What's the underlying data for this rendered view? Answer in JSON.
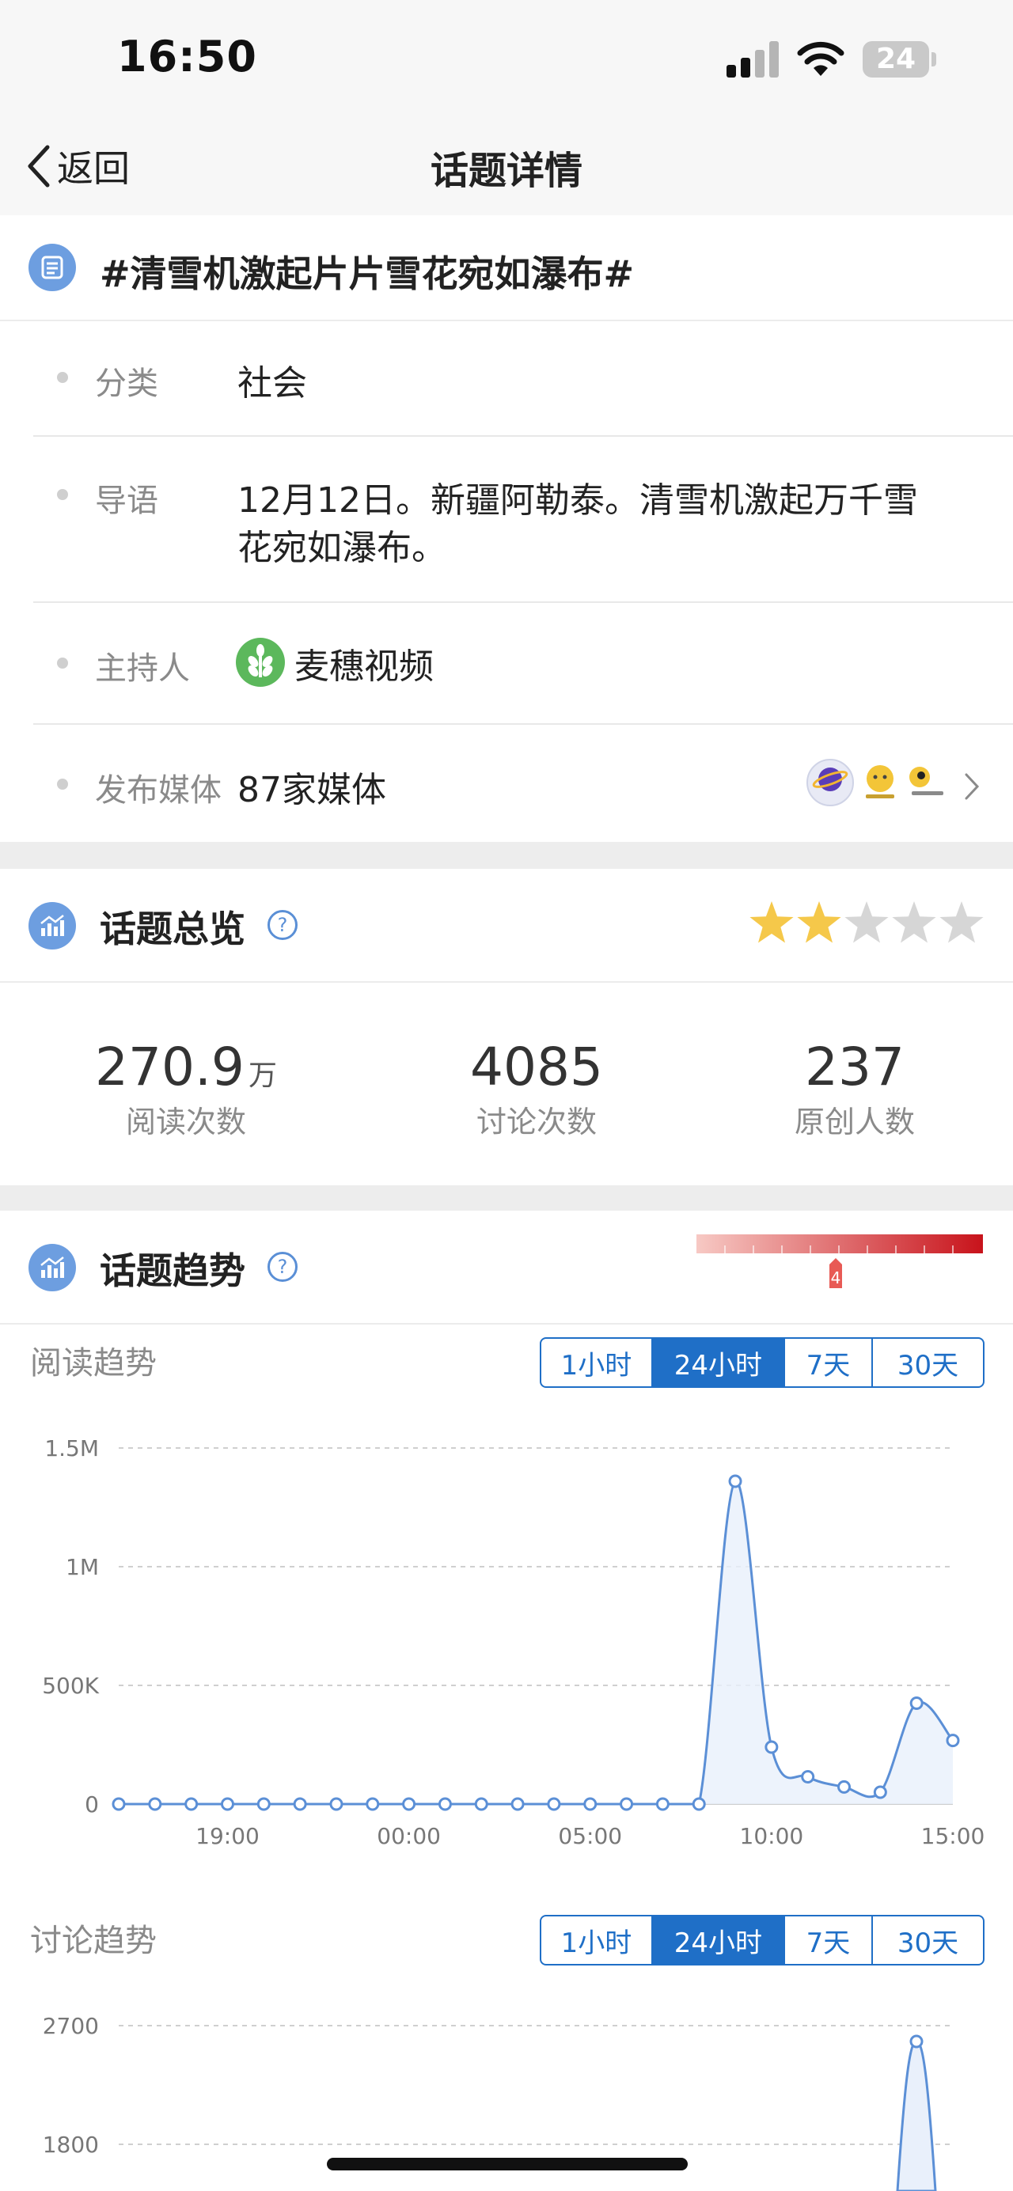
{
  "status_bar": {
    "time": "16:50",
    "battery": "24"
  },
  "nav": {
    "back_label": "返回",
    "title": "话题详情"
  },
  "topic": {
    "title": "#清雪机激起片片雪花宛如瀑布#",
    "category_label": "分类",
    "category_value": "社会",
    "intro_label": "导语",
    "intro_value_line1": "12月12日。新疆阿勒泰。清雪机激起万千雪",
    "intro_value_line2": "花宛如瀑布。",
    "host_label": "主持人",
    "host_value": "麦穗视频",
    "media_label": "发布媒体",
    "media_value": "87家媒体"
  },
  "overview": {
    "title": "话题总览",
    "rating": 2,
    "rating_max": 5,
    "stats": [
      {
        "value": "270.9",
        "unit": "万",
        "label": "阅读次数"
      },
      {
        "value": "4085",
        "unit": "",
        "label": "讨论次数"
      },
      {
        "value": "237",
        "unit": "",
        "label": "原创人数"
      }
    ]
  },
  "trend": {
    "title": "话题趋势",
    "heat_level": "4",
    "ranges": [
      "1小时",
      "24小时",
      "7天",
      "30天"
    ],
    "active_range": "24小时",
    "read_chart_title": "阅读趋势",
    "discuss_chart_title": "讨论趋势"
  },
  "colors": {
    "accent": "#1f6fc7",
    "chart_line": "#5b8fd6",
    "star_on": "#f5c84a",
    "star_off": "#d6d6d6"
  },
  "chart_data": [
    {
      "type": "area",
      "title": "阅读趋势",
      "x": [
        "16:00",
        "17:00",
        "18:00",
        "19:00",
        "20:00",
        "21:00",
        "22:00",
        "23:00",
        "00:00",
        "01:00",
        "02:00",
        "03:00",
        "04:00",
        "05:00",
        "06:00",
        "07:00",
        "08:00",
        "09:00",
        "10:00",
        "11:00",
        "12:00",
        "13:00",
        "14:00",
        "15:00"
      ],
      "x_tick_labels": [
        "19:00",
        "00:00",
        "05:00",
        "10:00",
        "15:00"
      ],
      "y_tick_labels": [
        "0",
        "500K",
        "1M",
        "1.5M"
      ],
      "series": [
        {
          "values": [
            0,
            0,
            0,
            0,
            0,
            0,
            0,
            0,
            0,
            0,
            0,
            0,
            0,
            0,
            0,
            0,
            0,
            1360000,
            240000,
            115000,
            72000,
            50000,
            425000,
            268000
          ]
        }
      ],
      "ylim": [
        0,
        1500000
      ],
      "grid": true
    },
    {
      "type": "area",
      "title": "讨论趋势",
      "y_tick_labels": [
        "1800",
        "2700"
      ],
      "series": [
        {
          "values": [
            2580
          ]
        }
      ],
      "grid": true
    }
  ]
}
